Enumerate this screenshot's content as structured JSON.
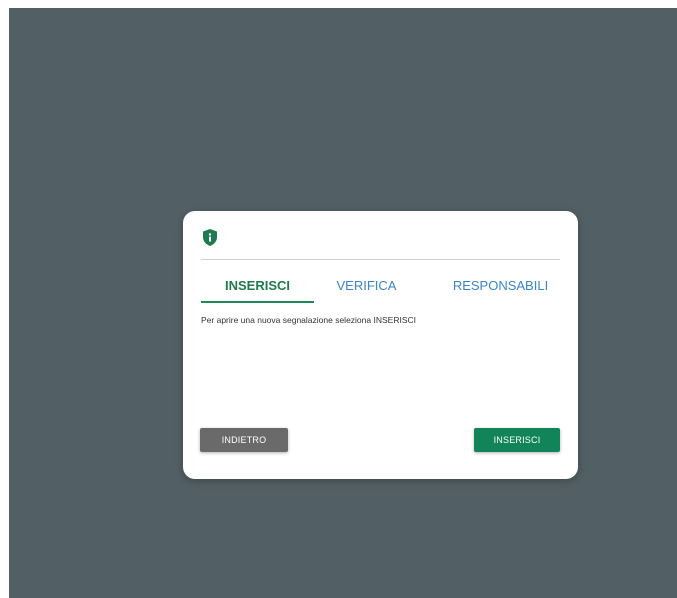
{
  "dialog": {
    "icon": "shield-info-icon",
    "tabs": [
      {
        "label": "INSERISCI",
        "active": true
      },
      {
        "label": "VERIFICA",
        "active": false
      },
      {
        "label": "RESPONSABILI",
        "active": false
      }
    ],
    "message": "Per aprire una nuova segnalazione seleziona INSERISCI",
    "back_label": "INDIETRO",
    "insert_label": "INSERISCI"
  },
  "colors": {
    "backdrop": "#525f64",
    "accent_green": "#1e7a4f",
    "link_blue": "#3a86c8",
    "button_grey": "#6a6a6a",
    "button_green": "#11845a"
  }
}
